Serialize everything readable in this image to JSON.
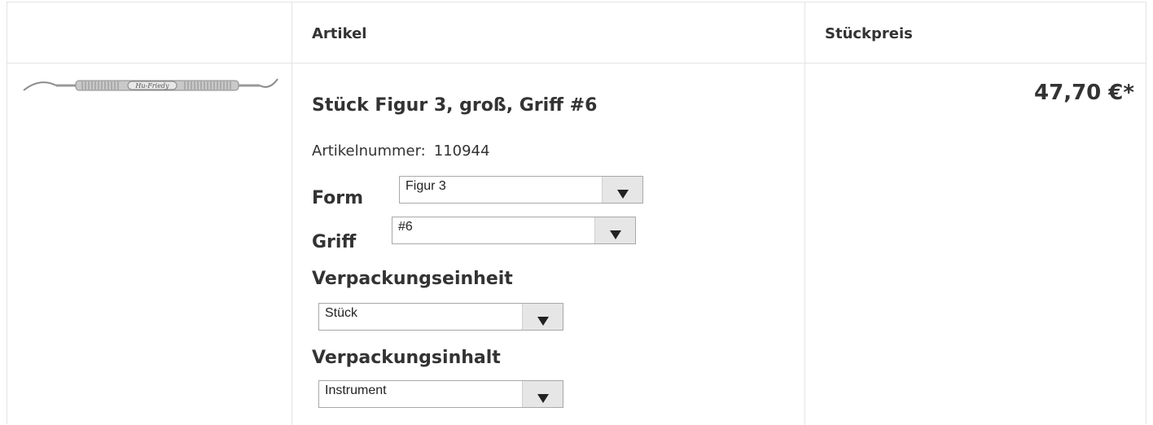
{
  "table": {
    "header": {
      "artikel": "Artikel",
      "stueckpreis": "Stückpreis"
    }
  },
  "product": {
    "image_icon": "dental-instrument-image",
    "brand_mark": "Hu-Friedy",
    "title": "Stück Figur 3, groß, Griff #6",
    "article_number_label": "Artikelnummer:",
    "article_number": "110944",
    "price": "47,70 €*"
  },
  "options": {
    "form": {
      "label": "Form",
      "selected": "Figur 3"
    },
    "griff": {
      "label": "Griff",
      "selected": "#6"
    },
    "verpackungseinheit": {
      "label": "Verpackungseinheit",
      "selected": "Stück"
    },
    "verpackungsinhalt": {
      "label": "Verpackungsinhalt",
      "selected": "Instrument"
    }
  },
  "colors": {
    "border": "#e4e4e4",
    "text": "#333333",
    "select_button": "#e6e6e6"
  }
}
